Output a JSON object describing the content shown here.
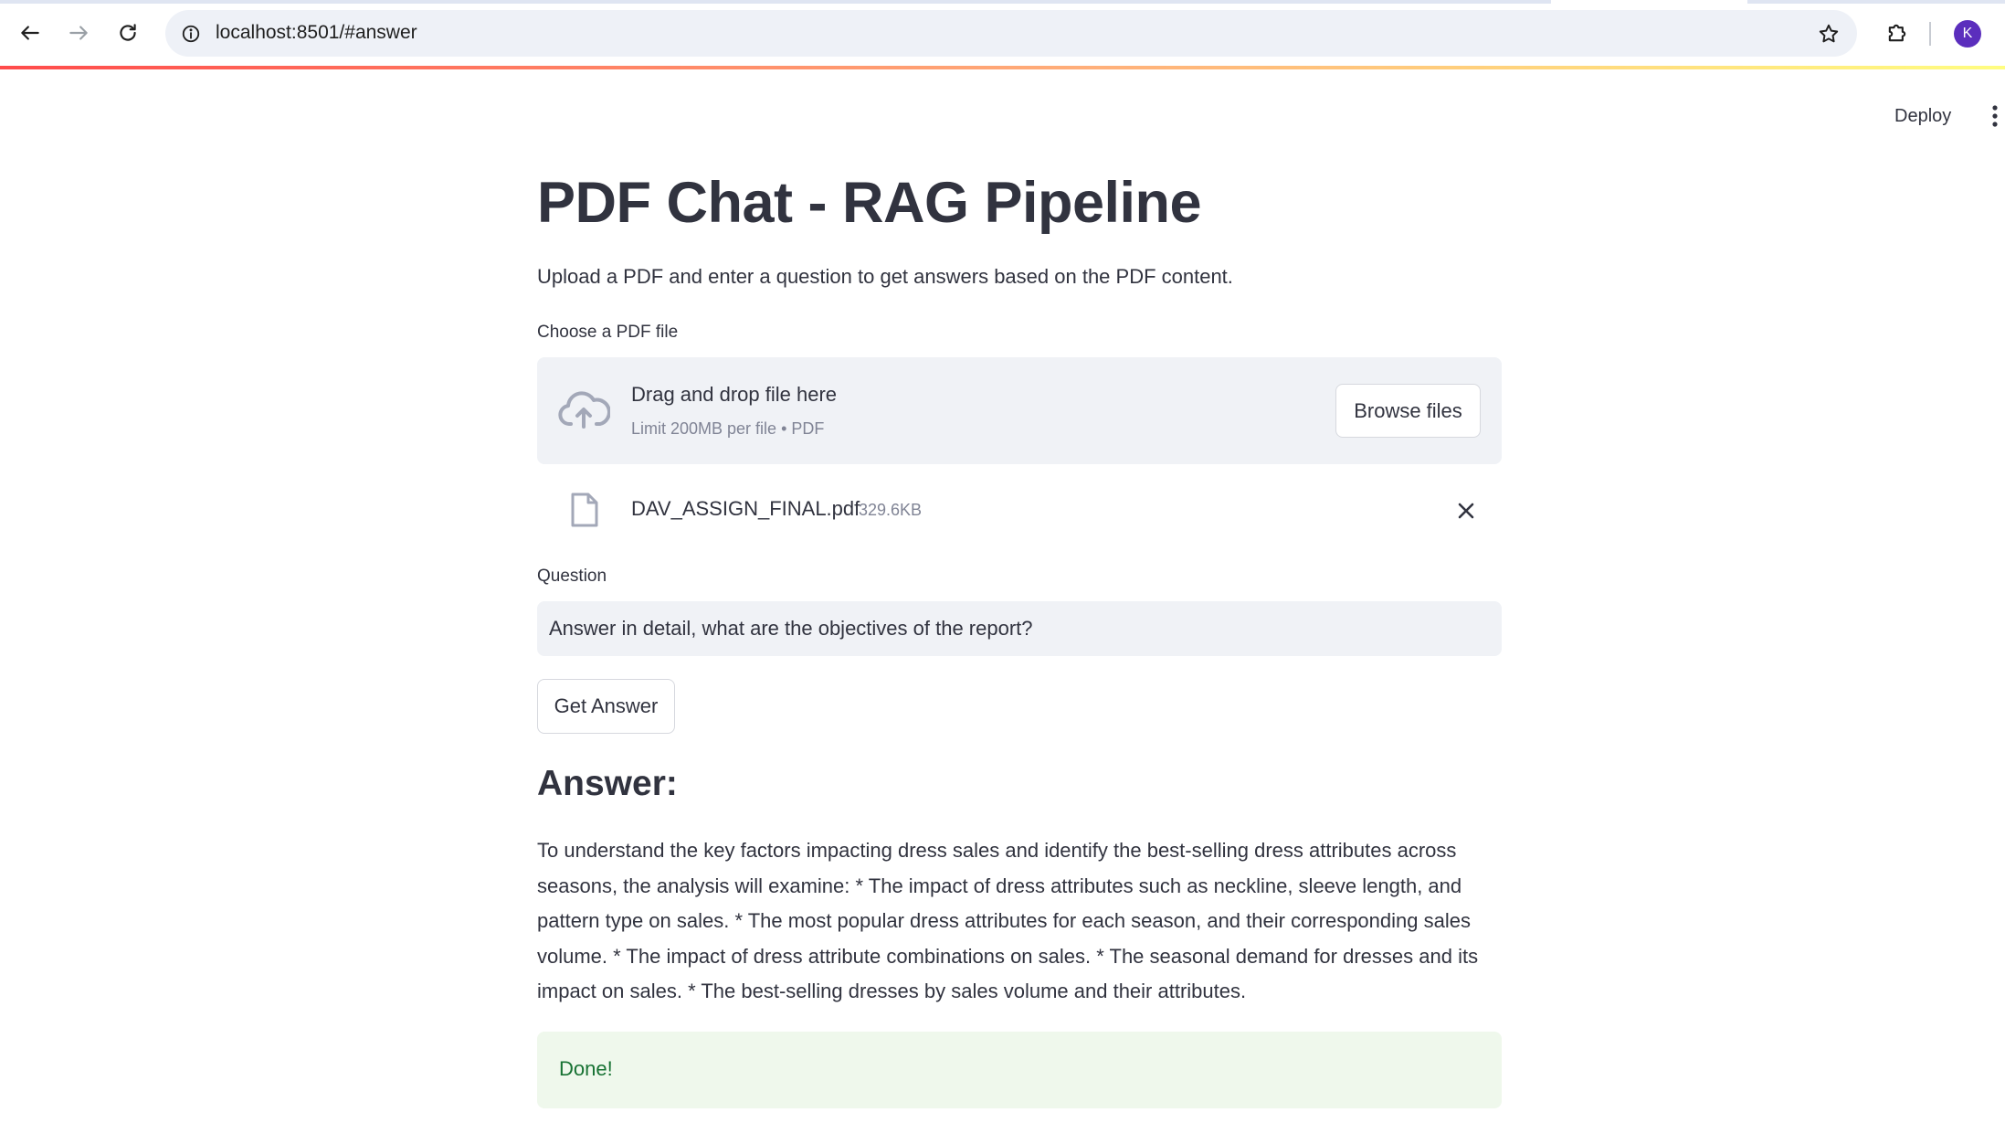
{
  "browser": {
    "url": "localhost:8501/#answer",
    "profile_initial": "K"
  },
  "header": {
    "deploy_label": "Deploy"
  },
  "page": {
    "title": "PDF Chat - RAG Pipeline",
    "subtitle": "Upload a PDF and enter a question to get answers based on the PDF content."
  },
  "uploader": {
    "label": "Choose a PDF file",
    "drop_title": "Drag and drop file here",
    "limit_text": "Limit 200MB per file • PDF",
    "browse_label": "Browse files",
    "file": {
      "name": "DAV_ASSIGN_FINAL.pdf",
      "size": "329.6KB"
    }
  },
  "question": {
    "label": "Question",
    "value": "Answer in detail, what are the objectives of the report?"
  },
  "actions": {
    "get_answer_label": "Get Answer"
  },
  "answer": {
    "heading": "Answer:",
    "text": "To understand the key factors impacting dress sales and identify the best-selling dress attributes across seasons, the analysis will examine: * The impact of dress attributes such as neckline, sleeve length, and pattern type on sales. * The most popular dress attributes for each season, and their corresponding sales volume. * The impact of dress attribute combinations on sales. * The seasonal demand for dresses and its impact on sales. * The best-selling dresses by sales volume and their attributes."
  },
  "status": {
    "message": "Done!"
  },
  "colors": {
    "primary_text": "#31333f",
    "secondary_background": "#f0f2f6",
    "success_background": "#eff8ec",
    "success_text": "#177233",
    "avatar": "#5b2ebd"
  }
}
